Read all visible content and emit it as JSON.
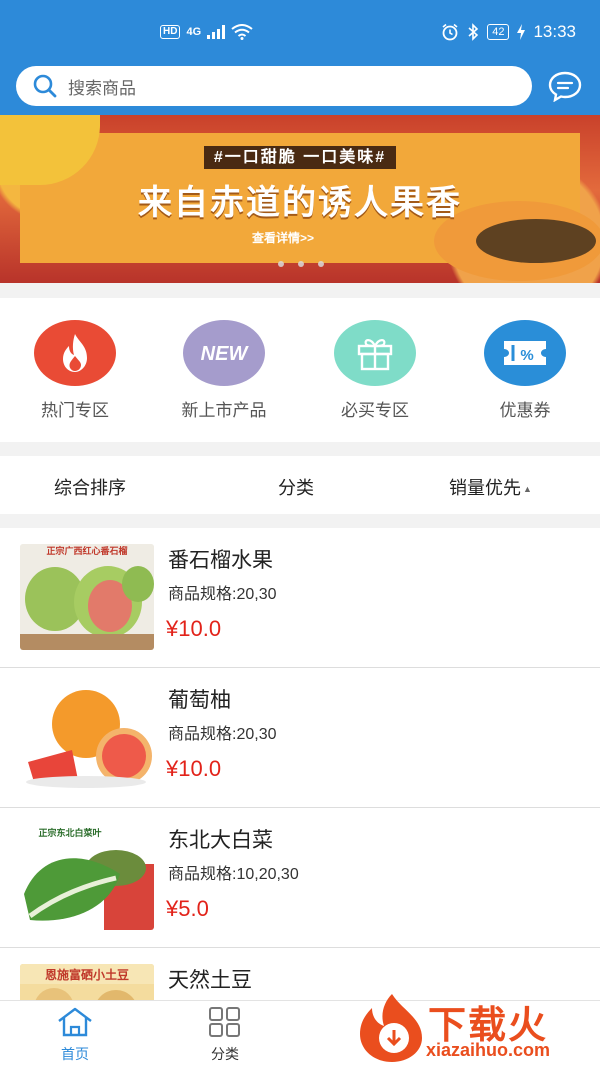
{
  "status_bar": {
    "hd": "HD",
    "network": "4G",
    "battery": "42",
    "time": "13:33"
  },
  "search": {
    "placeholder": "搜索商品",
    "icon": "search-icon",
    "message_icon": "chat-bubble-icon"
  },
  "banner": {
    "slogan_top": "#一口甜脆 一口美味#",
    "slogan_main": "来自赤道的诱人果香",
    "link": "查看详情>>",
    "slides": 3
  },
  "categories": [
    {
      "label": "热门专区",
      "icon": "flame-icon",
      "color": "#e94b35"
    },
    {
      "label": "新上市产品",
      "icon": "new-badge-icon",
      "color": "#a59ccc"
    },
    {
      "label": "必买专区",
      "icon": "gift-icon",
      "color": "#7fdcc8"
    },
    {
      "label": "优惠券",
      "icon": "coupon-icon",
      "color": "#2a8ed8"
    }
  ],
  "sort_bar": {
    "comprehensive": "综合排序",
    "category": "分类",
    "sales": "销量优先"
  },
  "products": [
    {
      "name": "番石榴水果",
      "spec": "商品规格:20,30",
      "price": "¥10.0",
      "image_text": "正宗广西红心番石榴"
    },
    {
      "name": "葡萄柚",
      "spec": "商品规格:20,30",
      "price": "¥10.0"
    },
    {
      "name": "东北大白菜",
      "spec": "商品规格:10,20,30",
      "price": "¥5.0",
      "image_text": "正宗东北白菜叶"
    },
    {
      "name": "天然土豆",
      "spec": "",
      "price": "",
      "image_text": "恩施富硒小土豆"
    }
  ],
  "bottom_nav": {
    "home": "首页",
    "category": "分类"
  },
  "watermark": {
    "title": "下载火",
    "url": "xiazaihuo.com"
  },
  "colors": {
    "primary": "#2d8ad9",
    "price": "#e2231a",
    "nav_active": "#2d8ad9"
  }
}
